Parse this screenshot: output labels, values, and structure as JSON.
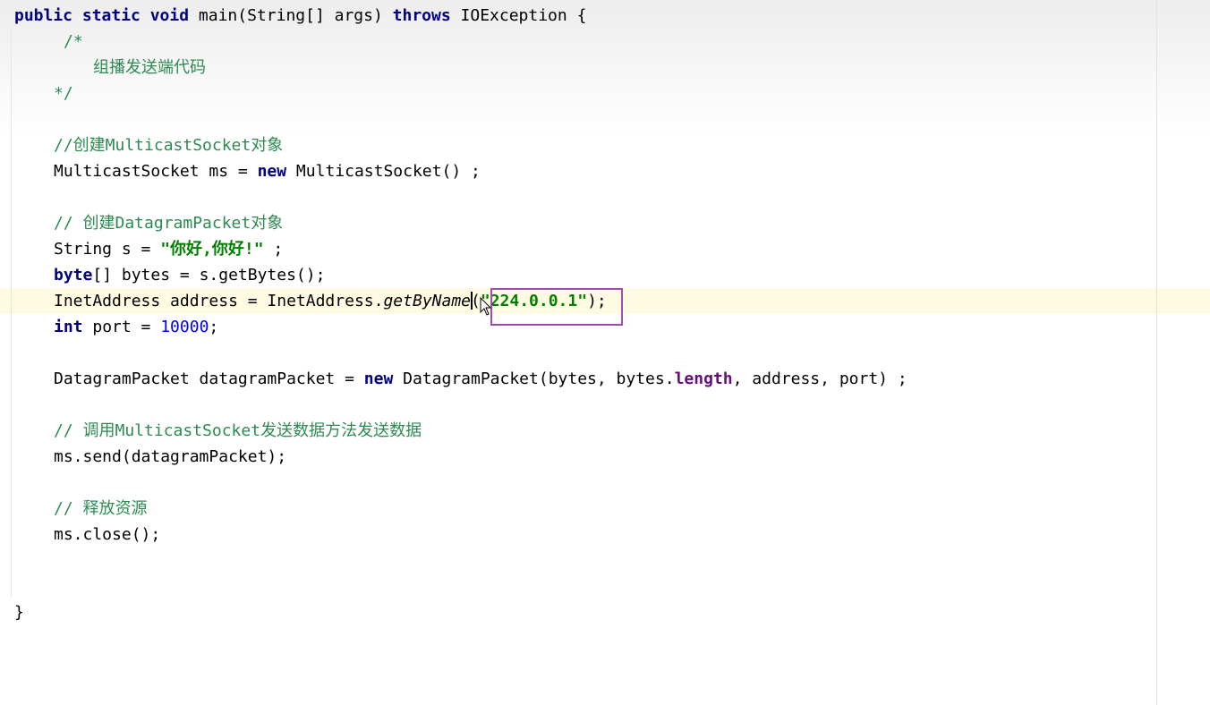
{
  "code_lines": {
    "l01": {
      "kw1": "public static void",
      "t1": " main(String[] args) ",
      "kw2": "throws",
      "t2": " IOException {"
    },
    "l02": {
      "cm": "/*"
    },
    "l03": {
      "cm": "组播发送端代码"
    },
    "l04": {
      "cm": "*/"
    },
    "l06": {
      "cm": "//创建MulticastSocket对象"
    },
    "l07": {
      "t1": "MulticastSocket ms = ",
      "kw1": "new",
      "t2": " MulticastSocket() ;"
    },
    "l09": {
      "cm": "// 创建DatagramPacket对象"
    },
    "l10": {
      "t1": "String s = ",
      "st": "\"你好,你好!\"",
      "t2": " ;"
    },
    "l11": {
      "kw1": "byte",
      "t1": "[] bytes = s.getBytes();"
    },
    "l12": {
      "t1": "InetAddress address = InetAddress.",
      "it": "getByName",
      "t2": "(",
      "st": "\"224.0.0.1\"",
      "t3": ");"
    },
    "l13": {
      "kw1": "int",
      "t1": " port = ",
      "num": "10000",
      "t2": ";"
    },
    "l15": {
      "t1": "DatagramPacket datagramPacket = ",
      "kw1": "new",
      "t2": " DatagramPacket(bytes, bytes.",
      "fld": "length",
      "t3": ", address, port) ;"
    },
    "l17": {
      "cm": "// 调用MulticastSocket发送数据方法发送数据"
    },
    "l18": {
      "t1": "ms.send(datagramPacket);"
    },
    "l20": {
      "cm": "// 释放资源"
    },
    "l21": {
      "t1": "ms.close();"
    },
    "l24": {
      "t1": "}"
    }
  },
  "colors": {
    "keyword": "#000080",
    "comment": "#2d8a52",
    "string": "#008000",
    "number": "#0000ff",
    "field": "#660e7a",
    "annotation_box": "#a44bb0",
    "caret_row": "#fffbe3"
  },
  "icons": {
    "mouse_cursor": "arrow-pointer-icon"
  }
}
